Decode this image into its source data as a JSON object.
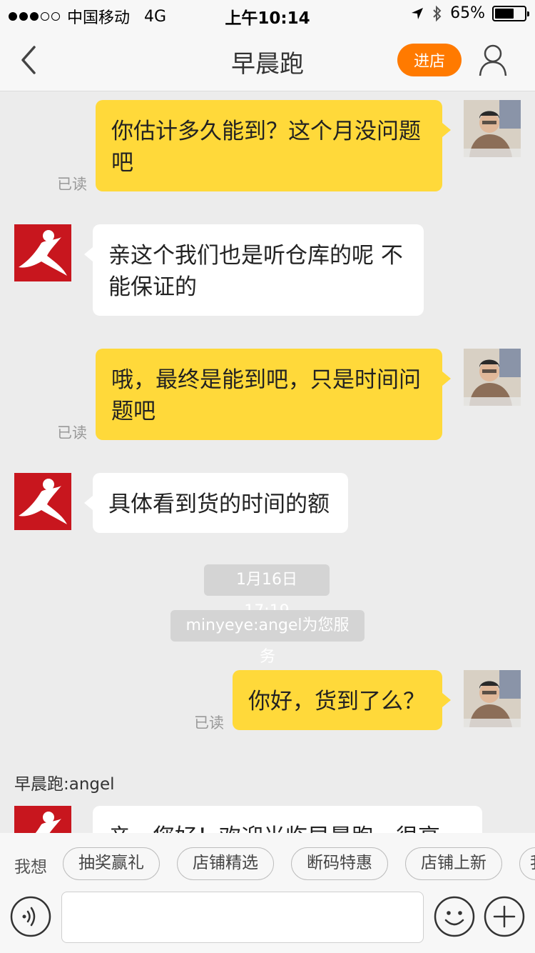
{
  "status_bar": {
    "carrier": "中国移动",
    "network": "4G",
    "time": "上午10:14",
    "battery": "65%",
    "battery_level": 0.65
  },
  "nav": {
    "title": "早晨跑",
    "enter_shop": "进店"
  },
  "messages": [
    {
      "side": "me",
      "text": "你估计多久能到？这个月没问题吧",
      "read": "已读"
    },
    {
      "side": "them",
      "text": "亲这个我们也是听仓库的呢 不能保证的"
    },
    {
      "side": "me",
      "text": "哦，最终是能到吧，只是时间问题吧",
      "read": "已读"
    },
    {
      "side": "them",
      "text": "具体看到货的时间的额"
    },
    {
      "side": "me",
      "text": "你好，货到了么？",
      "read": "已读"
    },
    {
      "side": "them",
      "text": "亲，您好！欢迎光临早晨跑，很高"
    }
  ],
  "system": {
    "timestamp": "1月16日 17:19",
    "service_notice": "minyeye:angel为您服务"
  },
  "sender_name": "早晨跑:angel",
  "quick_replies": {
    "label": "我想",
    "items": [
      "抽奖赢礼",
      "店铺精选",
      "断码特惠",
      "店铺上新",
      "我"
    ]
  },
  "input": {
    "placeholder": ""
  }
}
